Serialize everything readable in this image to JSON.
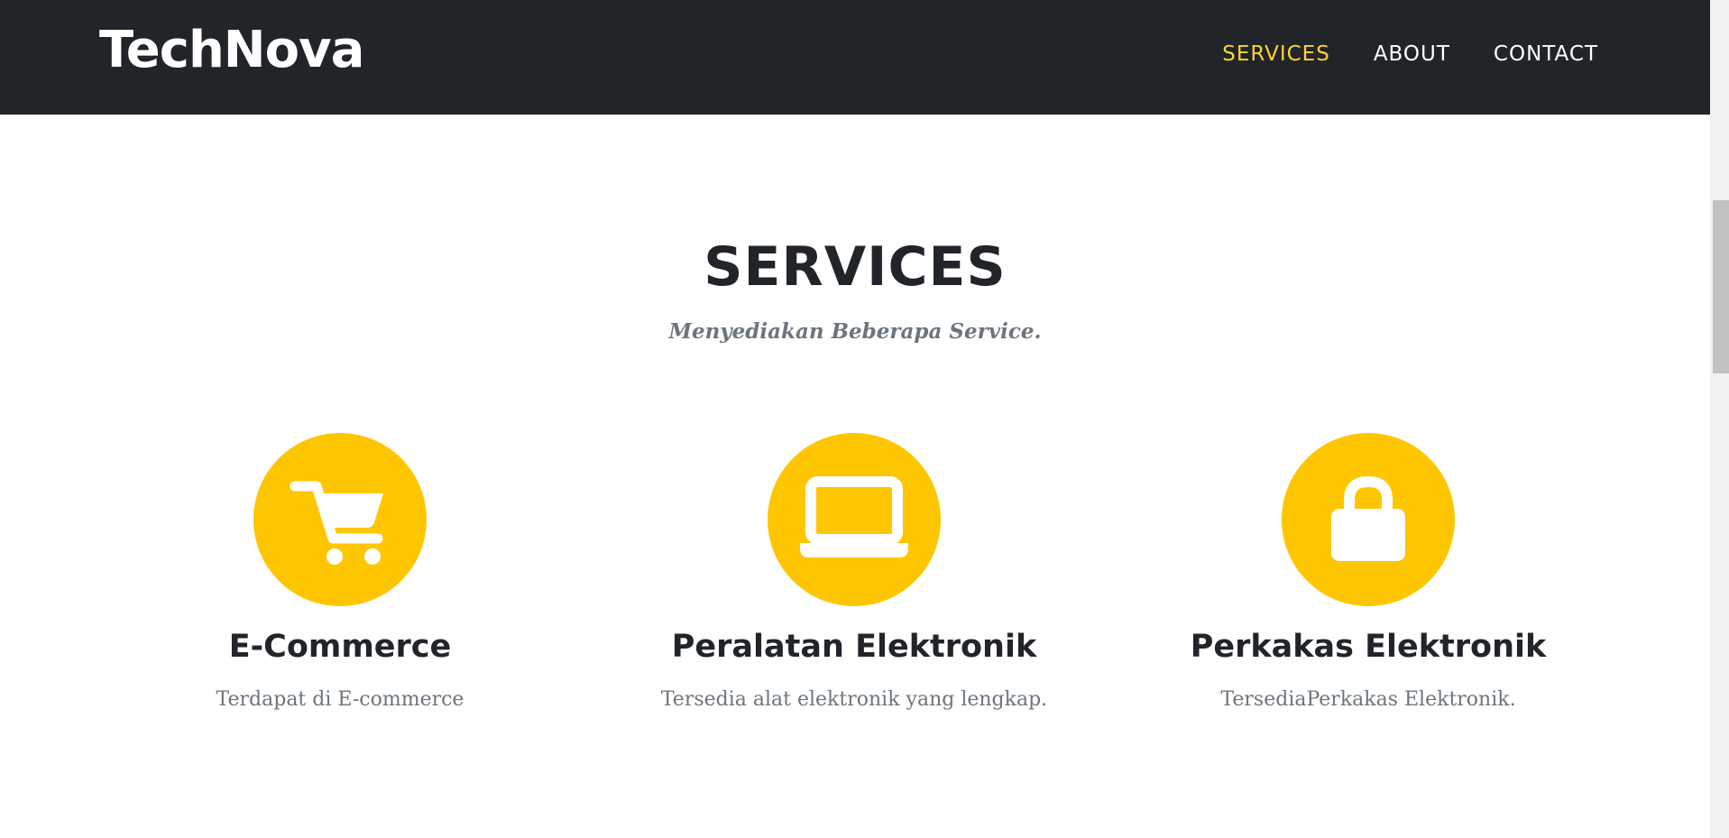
{
  "navbar": {
    "brand": "TechNova",
    "links": [
      {
        "label": "SERVICES",
        "active": true
      },
      {
        "label": "ABOUT",
        "active": false
      },
      {
        "label": "CONTACT",
        "active": false
      }
    ]
  },
  "section": {
    "heading": "SERVICES",
    "subheading": "Menyediakan Beberapa Service."
  },
  "services": [
    {
      "icon": "shopping-cart-icon",
      "title": "E-Commerce",
      "text": "Terdapat di E-commerce"
    },
    {
      "icon": "laptop-icon",
      "title": "Peralatan Elektronik",
      "text": "Tersedia alat elektronik yang lengkap."
    },
    {
      "icon": "lock-icon",
      "title": "Perkakas Elektronik",
      "text": "TersediaPerkakas Elektronik."
    }
  ],
  "colors": {
    "navbar_bg": "#212529",
    "accent": "#fed136",
    "icon_circle": "#fec601",
    "heading": "#212529",
    "muted": "#6c757d"
  }
}
